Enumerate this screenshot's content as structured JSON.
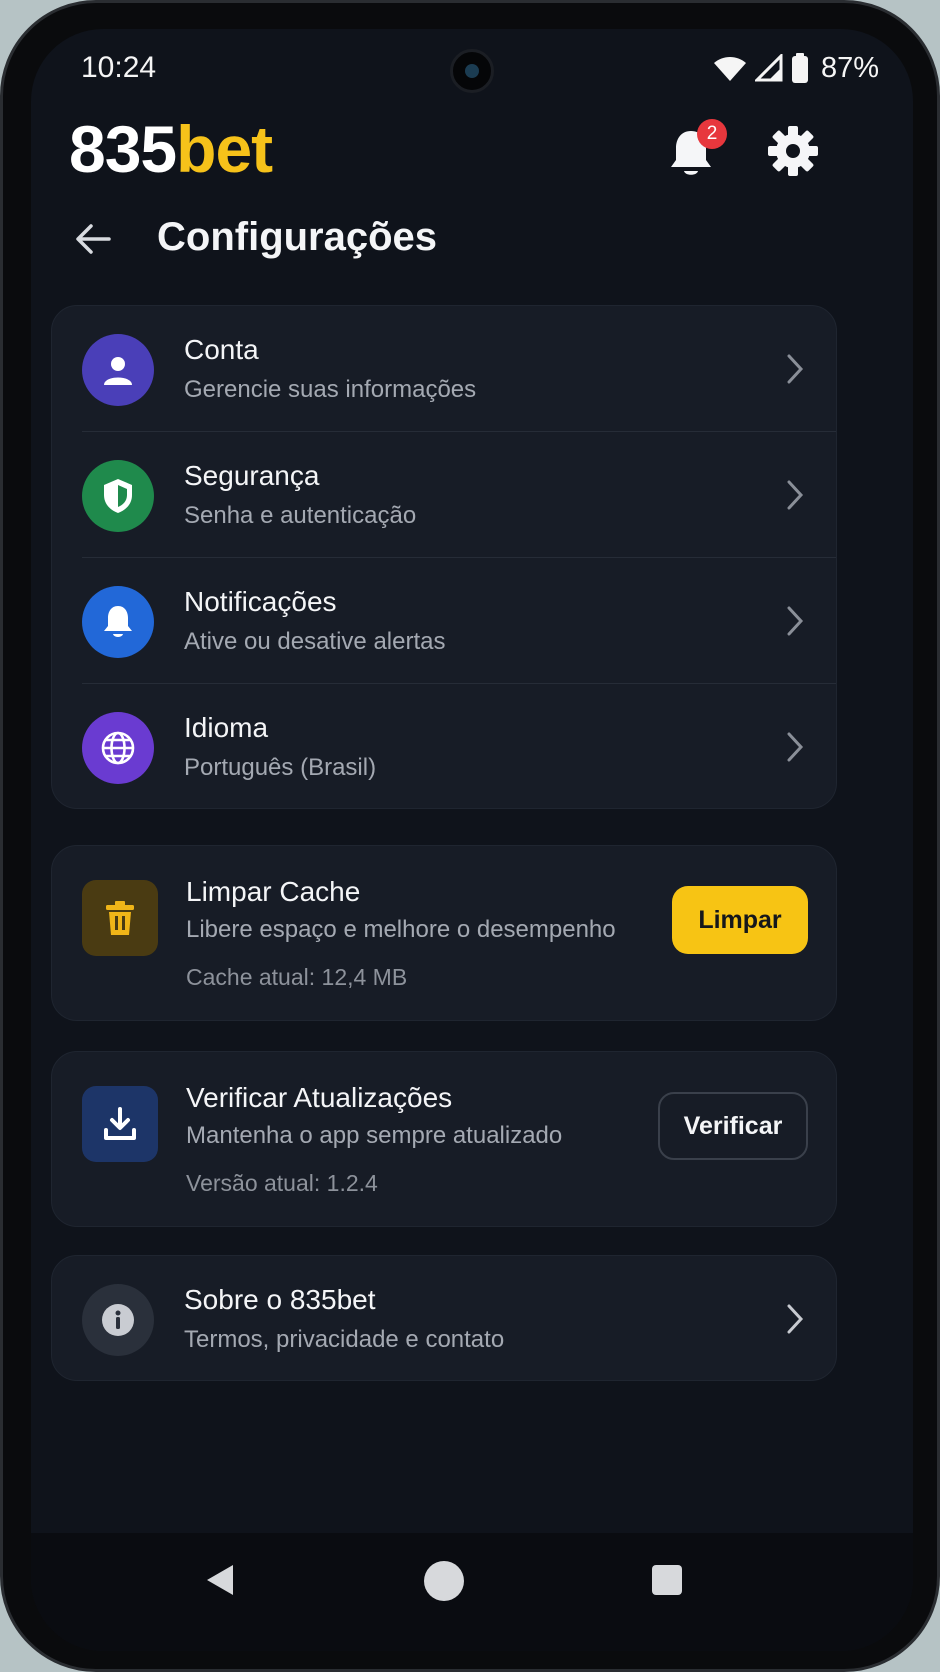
{
  "status": {
    "time": "10:24",
    "battery": "87%"
  },
  "header": {
    "logo_number": "835",
    "logo_brand": "bet",
    "notification_count": "2",
    "title": "Configurações"
  },
  "menu": [
    {
      "title": "Conta",
      "subtitle": "Gerencie suas informações",
      "icon": "user-icon",
      "color": "#4a3fb8"
    },
    {
      "title": "Segurança",
      "subtitle": "Senha e autenticação",
      "icon": "shield-icon",
      "color": "#1f8a4c"
    },
    {
      "title": "Notificações",
      "subtitle": "Ative ou desative alertas",
      "icon": "bell-icon",
      "color": "#2268d8"
    },
    {
      "title": "Idioma",
      "subtitle": "Português (Brasil)",
      "icon": "globe-icon",
      "color": "#6a3bd1"
    }
  ],
  "cache": {
    "title": "Limpar Cache",
    "subtitle": "Libere espaço e melhore o desempenho",
    "meta": "Cache atual: 12,4 MB",
    "button": "Limpar",
    "icon": "trash-icon"
  },
  "update": {
    "title": "Verificar Atualizações",
    "subtitle": "Mantenha o app sempre atualizado",
    "meta": "Versão atual: 1.2.4",
    "button": "Verificar",
    "icon": "download-icon"
  },
  "about": {
    "title": "Sobre o 835bet",
    "subtitle": "Termos, privacidade e contato",
    "icon": "info-icon"
  },
  "colors": {
    "accent": "#f6c21a",
    "background": "#0f131b",
    "card": "#171c26"
  }
}
